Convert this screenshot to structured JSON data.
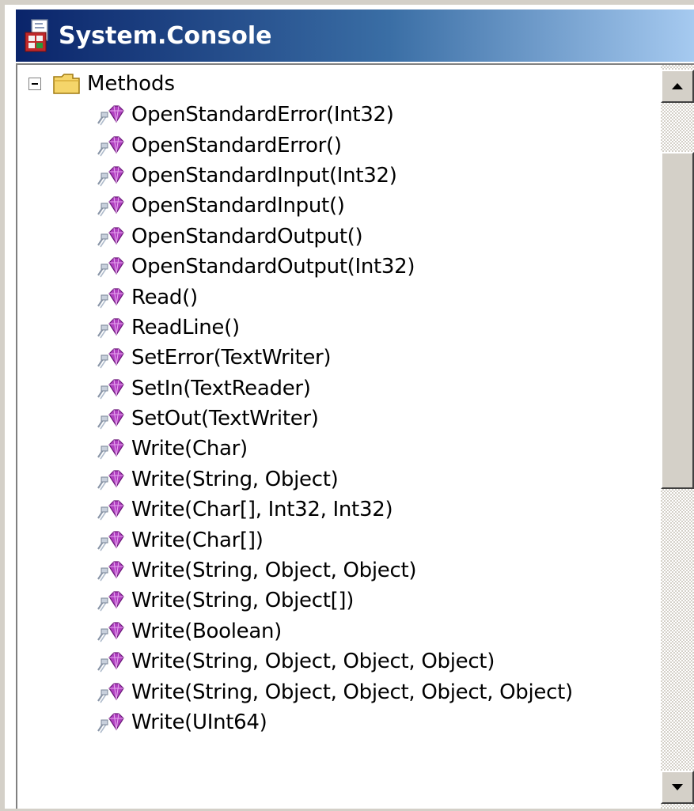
{
  "window": {
    "title": "System.Console"
  },
  "tree": {
    "root": {
      "label": "Methods",
      "expanded": true,
      "icon": "folder-icon"
    },
    "methods": [
      "OpenStandardError(Int32)",
      "OpenStandardError()",
      "OpenStandardInput(Int32)",
      "OpenStandardInput()",
      "OpenStandardOutput()",
      "OpenStandardOutput(Int32)",
      "Read()",
      "ReadLine()",
      "SetError(TextWriter)",
      "SetIn(TextReader)",
      "SetOut(TextWriter)",
      "Write(Char)",
      "Write(String, Object)",
      "Write(Char[], Int32, Int32)",
      "Write(Char[])",
      "Write(String, Object, Object)",
      "Write(String, Object[])",
      "Write(Boolean)",
      "Write(String, Object, Object, Object)",
      "Write(String, Object, Object, Object, Object)",
      "Write(UInt64)"
    ],
    "method_icon": "static-method-icon"
  },
  "scrollbar": {
    "up_icon": "scroll-up-arrow-icon",
    "down_icon": "scroll-down-arrow-icon"
  },
  "colors": {
    "titlebar_start": "#0a246a",
    "titlebar_end": "#a6caf0",
    "method_icon": "#b040c0",
    "folder": "#f5d56a"
  }
}
